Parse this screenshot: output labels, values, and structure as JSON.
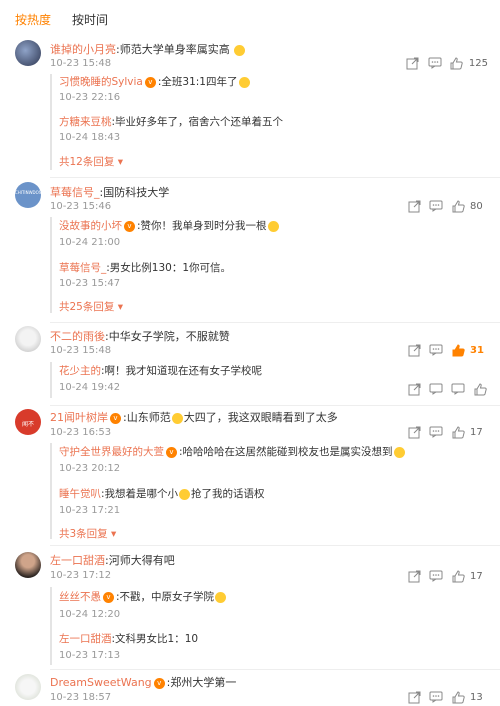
{
  "sort_tabs": {
    "hot": "按热度",
    "time": "按时间"
  },
  "colors": {
    "accent": "#ff8200",
    "username": "#eb7350"
  },
  "comments": [
    {
      "user": "谁掉的小月亮",
      "text": ":师范大学单身率属实高",
      "time": "10-23 15:48",
      "likes": "125",
      "replies": [
        {
          "user": "习惯晚睡的Sylvia",
          "text": ":全班31:1四年了",
          "time": "10-23 22:16"
        },
        {
          "user": "方糖来豆桃",
          "text": ":毕业好多年了，宿舍六个还单着五个",
          "time": "10-24 18:43"
        }
      ],
      "more": "共12条回复"
    },
    {
      "user": "草莓信号_",
      "avatar_text": "CHITINWDOSTOOSTO",
      "text": ":国防科技大学",
      "time": "10-23 15:46",
      "likes": "80",
      "replies": [
        {
          "user": "没故事的小坏",
          "text": ":赞你！我单身到时分我一根",
          "time": "10-24 21:00"
        },
        {
          "user": "草莓信号_",
          "text": ":男女比例130：1你可信。",
          "time": "10-23 15:47"
        }
      ],
      "more": "共25条回复"
    },
    {
      "user": "不二的雨後",
      "text": ":中华女子学院，不服就赞",
      "time": "10-23 15:48",
      "likes": "31",
      "replies": [
        {
          "user": "花少主的",
          "text": ":啊！我才知道现在还有女子学校呢",
          "time": "10-24 19:42"
        }
      ]
    },
    {
      "user": "21闻叶树岸",
      "avatar_text": "闻不",
      "text": ":山东师范",
      "text2": "大四了，我这双眼睛看到了太多",
      "time": "10-23 16:53",
      "likes": "17",
      "replies": [
        {
          "user": "守护全世界最好的大萱",
          "text": ":哈哈哈哈在这居然能碰到校友也是属实没想到",
          "time": "10-23 20:12"
        },
        {
          "user": "睡午觉叭",
          "text": ":我想着是哪个小",
          "text2": "抢了我的话语权",
          "time": "10-23 17:21"
        }
      ],
      "more": "共3条回复"
    },
    {
      "user": "左一口甜酒",
      "text": ":河师大得有吧",
      "time": "10-23 17:12",
      "likes": "17",
      "replies": [
        {
          "user": "丝丝不愚",
          "text": ":不戳，中原女子学院",
          "time": "10-24 12:20"
        },
        {
          "user": "左一口甜酒",
          "text": ":文科男女比1：10",
          "time": "10-23 17:13"
        }
      ]
    },
    {
      "user": "DreamSweetWang",
      "text": ":郑州大学第一",
      "time": "10-23 18:57",
      "likes": "13"
    }
  ]
}
